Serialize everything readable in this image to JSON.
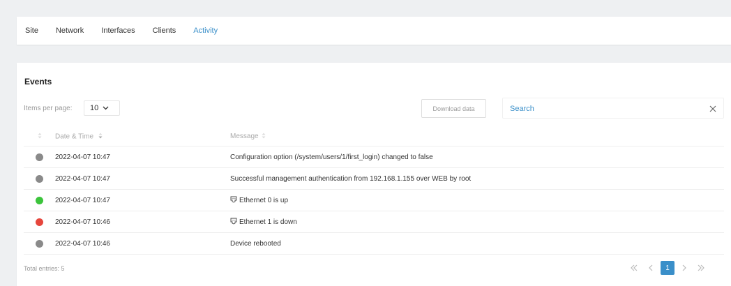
{
  "tabs": [
    {
      "label": "Site"
    },
    {
      "label": "Network"
    },
    {
      "label": "Interfaces"
    },
    {
      "label": "Clients"
    },
    {
      "label": "Activity"
    }
  ],
  "events": {
    "title": "Events",
    "items_per_page_label": "Items per page:",
    "items_per_page_value": "10",
    "download_label": "Download data",
    "search_placeholder": "Search",
    "columns": {
      "date": "Date & Time",
      "message": "Message"
    },
    "rows": [
      {
        "status": "gray",
        "date": "2022-04-07 10:47",
        "message": "Configuration option (/system/users/1/first_login) changed to false",
        "icon": ""
      },
      {
        "status": "gray",
        "date": "2022-04-07 10:47",
        "message": "Successful management authentication from 192.168.1.155 over WEB by root",
        "icon": ""
      },
      {
        "status": "green",
        "date": "2022-04-07 10:47",
        "message": "Ethernet 0 is up",
        "icon": "ethernet-port-icon"
      },
      {
        "status": "red",
        "date": "2022-04-07 10:46",
        "message": "Ethernet 1 is down",
        "icon": "ethernet-port-icon"
      },
      {
        "status": "gray",
        "date": "2022-04-07 10:46",
        "message": "Device rebooted",
        "icon": ""
      }
    ],
    "total_label": "Total entries: 5",
    "current_page": "1"
  },
  "colors": {
    "gray": "#8a8a8a",
    "green": "#3cc43c",
    "red": "#e6463c",
    "accent": "#3a8fc9"
  }
}
